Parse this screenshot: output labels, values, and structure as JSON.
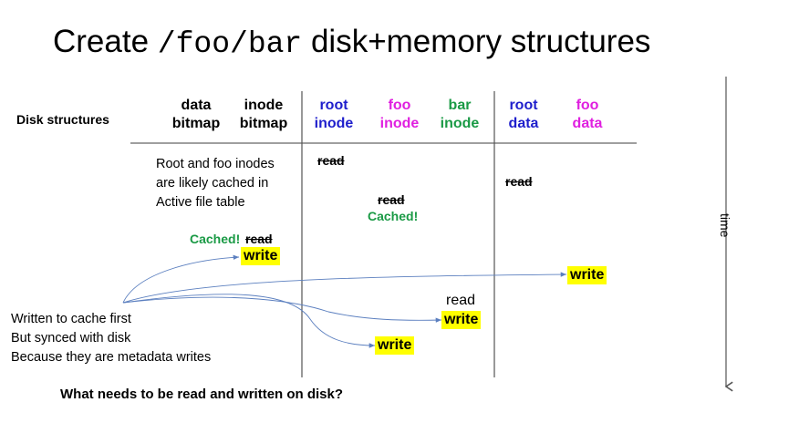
{
  "title": {
    "prefix": "Create",
    "path": "/foo/bar",
    "suffix": "disk+memory structures"
  },
  "row_label": "Disk structures",
  "columns": [
    {
      "line1": "data",
      "line2": "bitmap",
      "color": "#000000"
    },
    {
      "line1": "inode",
      "line2": "bitmap",
      "color": "#000000"
    },
    {
      "line1": "root",
      "line2": "inode",
      "color": "#1f1fcc"
    },
    {
      "line1": "foo",
      "line2": "inode",
      "color": "#e020e0"
    },
    {
      "line1": "bar",
      "line2": "inode",
      "color": "#1a9a45"
    },
    {
      "line1": "root",
      "line2": "data",
      "color": "#1f1fcc"
    },
    {
      "line1": "foo",
      "line2": "data",
      "color": "#e020e0"
    }
  ],
  "notes": {
    "cached_inodes": [
      "Root and foo inodes",
      "are likely cached in",
      "Active file table"
    ],
    "written": [
      "Written to cache first",
      "But synced with disk",
      "Because they are metadata writes"
    ],
    "question": "What needs to be read and written on disk?"
  },
  "ops": {
    "read": "read",
    "write": "write",
    "cached": "Cached!"
  },
  "time_label": "time",
  "colors": {
    "highlight": "#ffff00",
    "cached_green": "#1a9a45",
    "arrow_blue": "#5b7fbf"
  }
}
